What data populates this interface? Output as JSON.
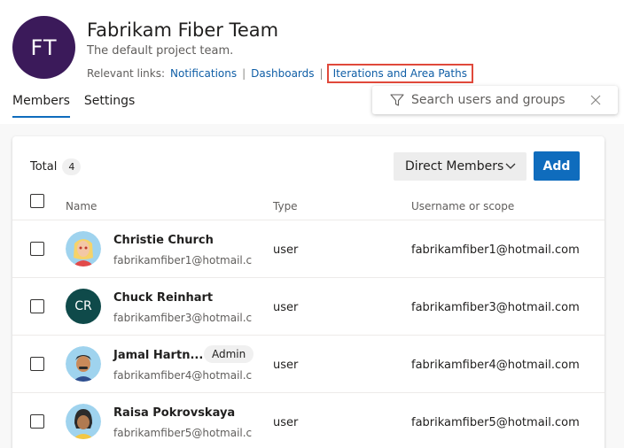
{
  "team": {
    "initials": "FT",
    "name": "Fabrikam Fiber Team",
    "description": "The default project team.",
    "relevant_links_label": "Relevant links:",
    "links": [
      "Notifications",
      "Dashboards",
      "Iterations and Area Paths"
    ],
    "separator": "|"
  },
  "tabs": [
    {
      "label": "Members",
      "active": true
    },
    {
      "label": "Settings",
      "active": false
    }
  ],
  "search": {
    "placeholder": "Search users and groups",
    "value": ""
  },
  "members": {
    "total_label": "Total",
    "total_count": "4",
    "filter_label": "Direct Members",
    "add_label": "Add",
    "columns": [
      "Name",
      "Type",
      "Username or scope"
    ],
    "rows": [
      {
        "name": "Christie Church",
        "email": "fabrikamfiber1@hotmail.com",
        "type": "user",
        "scope": "fabrikamfiber1@hotmail.com",
        "badge": "",
        "avatar": "christie-church-avatar"
      },
      {
        "name": "Chuck Reinhart",
        "initials": "CR",
        "email": "fabrikamfiber3@hotmail.com",
        "type": "user",
        "scope": "fabrikamfiber3@hotmail.com",
        "badge": "",
        "avatar": "initials"
      },
      {
        "name": "Jamal Hartn...",
        "email": "fabrikamfiber4@hotmail.com",
        "type": "user",
        "scope": "fabrikamfiber4@hotmail.com",
        "badge": "Admin",
        "avatar": "jamal-avatar"
      },
      {
        "name": "Raisa Pokrovskaya",
        "email": "fabrikamfiber5@hotmail.com",
        "type": "user",
        "scope": "fabrikamfiber5@hotmail.com",
        "badge": "",
        "avatar": "raisa-avatar"
      }
    ]
  },
  "colors": {
    "accent": "#0f6cbd",
    "team_avatar": "#3b1a5a",
    "link": "#0f5ea6",
    "highlight_border": "#e0493b",
    "initials_avatar": "#0f4a4a"
  }
}
